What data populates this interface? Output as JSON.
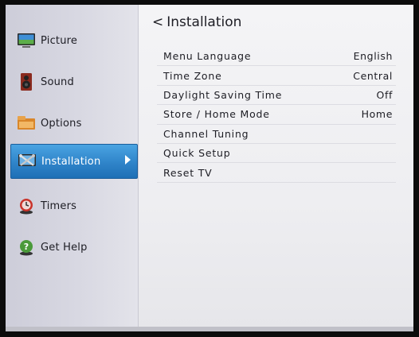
{
  "sidebar": {
    "items": [
      {
        "label": "Picture",
        "icon": "picture-icon"
      },
      {
        "label": "Sound",
        "icon": "speaker-icon"
      },
      {
        "label": "Options",
        "icon": "options-icon"
      },
      {
        "label": "Installation",
        "icon": "tools-icon",
        "selected": true
      },
      {
        "label": "Timers",
        "icon": "timer-icon"
      },
      {
        "label": "Get Help",
        "icon": "help-icon"
      }
    ]
  },
  "main": {
    "back_glyph": "<",
    "title": "Installation",
    "rows": [
      {
        "label": "Menu Language",
        "value": "English"
      },
      {
        "label": "Time Zone",
        "value": "Central"
      },
      {
        "label": "Daylight Saving Time",
        "value": "Off"
      },
      {
        "label": "Store / Home Mode",
        "value": "Home"
      },
      {
        "label": "Channel Tuning",
        "value": ""
      },
      {
        "label": "Quick Setup",
        "value": ""
      },
      {
        "label": "Reset TV",
        "value": ""
      }
    ]
  },
  "colors": {
    "selection": "#2f84c9",
    "text": "#1d1d24",
    "background": "#f0f0f3"
  }
}
